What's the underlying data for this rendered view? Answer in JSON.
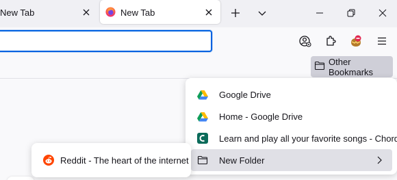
{
  "tabs": [
    {
      "title": "New Tab",
      "active": false
    },
    {
      "title": "New Tab",
      "active": true
    }
  ],
  "toolbar": {
    "new_tab_icon": "plus-icon",
    "list_tabs_icon": "chevron-down-icon"
  },
  "window_controls": {
    "minimize_icon": "minimize-icon",
    "restore_icon": "restore-icon",
    "close_icon": "close-icon"
  },
  "urlbar": {
    "value": "",
    "placeholder": ""
  },
  "nav_buttons": [
    "account-icon",
    "extensions-icon",
    "addon-icon",
    "hamburger-menu-icon"
  ],
  "bookmarks_toolbar": {
    "other_bookmarks_label": "Other Bookmarks"
  },
  "bookmarks_menu": {
    "items": [
      {
        "label": "Google Drive",
        "icon": "google-drive-icon"
      },
      {
        "label": "Home - Google Drive",
        "icon": "google-drive-icon"
      },
      {
        "label": "Learn and play all your favorite songs - Chordify",
        "icon": "chordify-icon"
      },
      {
        "label": "New Folder",
        "icon": "folder-icon",
        "has_submenu": true
      }
    ]
  },
  "submenu": {
    "items": [
      {
        "label": "Reddit - The heart of the internet",
        "icon": "reddit-icon"
      }
    ]
  },
  "colors": {
    "accent": "#0061e0",
    "tabstrip_bg": "#f0f0f4",
    "highlight": "#e0e0e6"
  }
}
